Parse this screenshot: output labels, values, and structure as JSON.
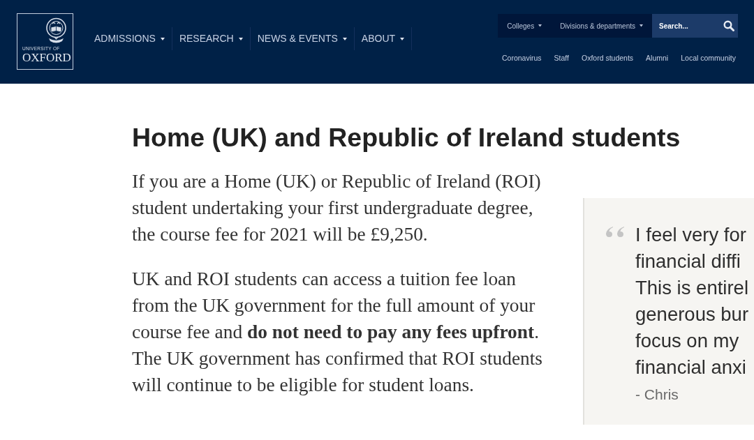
{
  "header": {
    "logo": {
      "line_1": "UNIVERSITY OF",
      "line_2": "OXFORD"
    },
    "nav": [
      {
        "label": "ADMISSIONS"
      },
      {
        "label": "RESEARCH"
      },
      {
        "label": "NEWS & EVENTS"
      },
      {
        "label": "ABOUT"
      }
    ],
    "utility_menus": [
      {
        "label": "Colleges"
      },
      {
        "label": "Divisions & departments"
      }
    ],
    "search": {
      "placeholder": "Search..."
    },
    "quick_links": [
      "Coronavirus",
      "Staff",
      "Oxford students",
      "Alumni",
      "Local community"
    ]
  },
  "main": {
    "heading": "Home (UK) and Republic of Ireland students",
    "paragraphs": [
      "If you are a Home (UK) or Republic of Ireland (ROI) student undertaking your first undergraduate degree, the course fee for 2021 will be £9,250.",
      "UK and ROI students can access a tuition fee loan from the UK government for the full amount of your course fee and **do not need to pay any fees upfront**. The UK government has confirmed that ROI students will continue to be eligible for student loans."
    ]
  },
  "quote": {
    "lines": [
      "I feel very for",
      "financial diffi",
      "This is entirel",
      "generous bur",
      "focus on my",
      "financial anxi"
    ],
    "attribution": "- Chris"
  }
}
